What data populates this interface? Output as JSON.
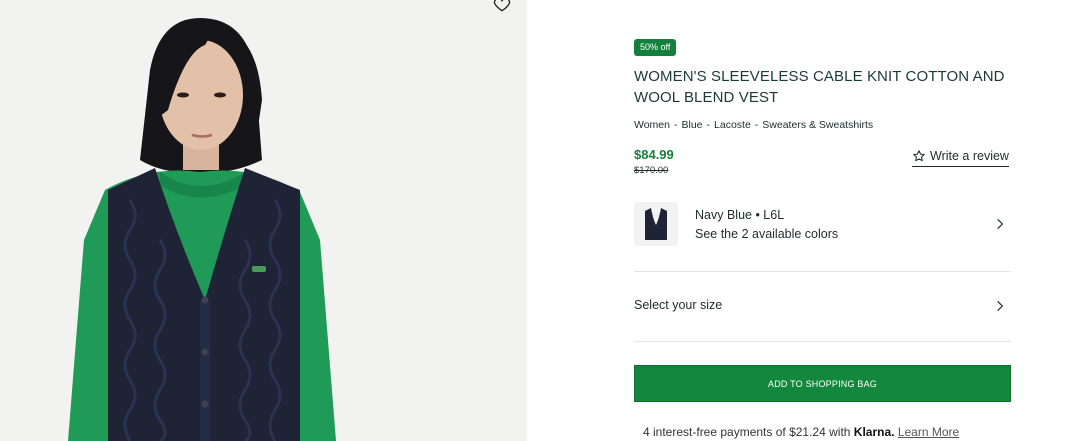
{
  "product": {
    "badge": "50% off",
    "title": "WOMEN'S SLEEVELESS CABLE KNIT COTTON AND WOOL BLEND VEST",
    "breadcrumb": [
      "Women",
      "Blue",
      "Lacoste",
      "Sweaters & Sweatshirts"
    ],
    "breadcrumb_sep": "-",
    "price": "$84.99",
    "old_price": "$170.00",
    "review_label": "Write a review"
  },
  "color": {
    "name": "Navy Blue • L6L",
    "available": "See the 2 available colors"
  },
  "size": {
    "label": "Select your size"
  },
  "cart": {
    "add_label": "ADD TO SHOPPING BAG"
  },
  "klarna": {
    "prefix": "4 interest-free payments of $21.24 with",
    "brand": "Klarna.",
    "learn_more": "Learn More"
  },
  "colors": {
    "accent_green": "#13803b",
    "vest_navy": "#1e2336",
    "sweater_green": "#1f9a57"
  }
}
